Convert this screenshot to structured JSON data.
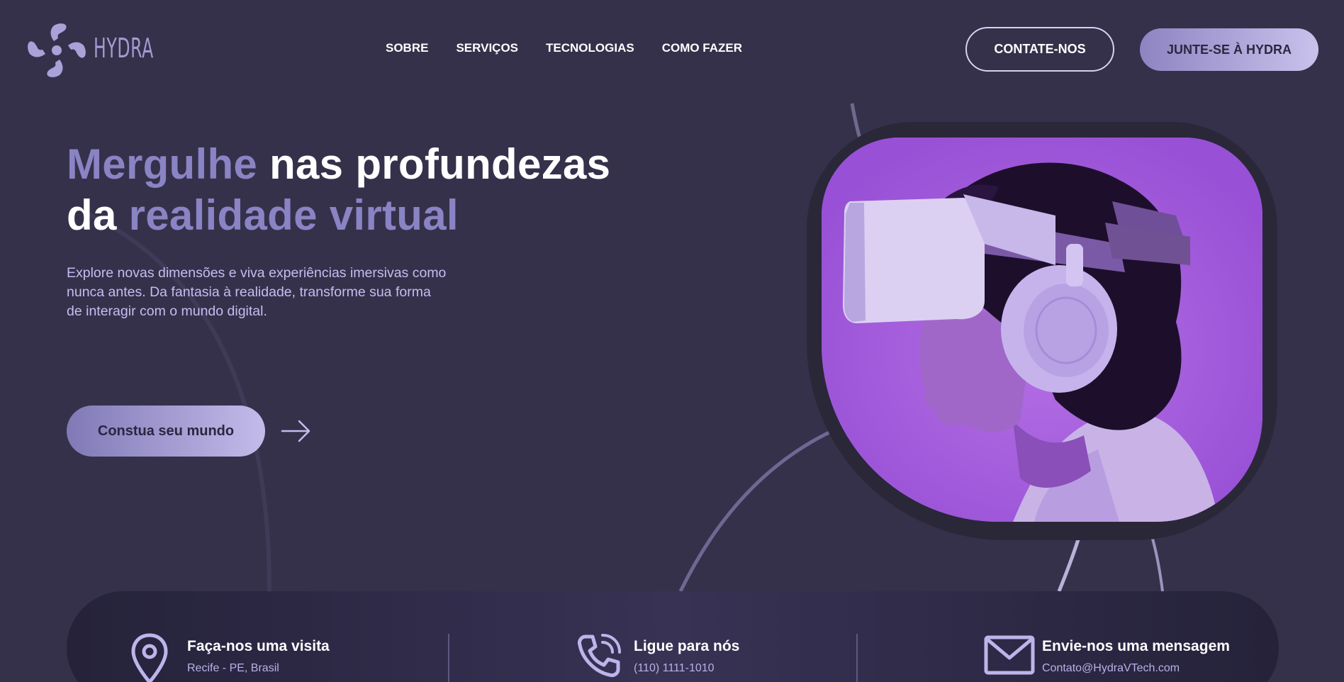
{
  "brand": {
    "name": "HYDRA",
    "logo_icon": "hydra-swirl-logo"
  },
  "nav": {
    "items": [
      "SOBRE",
      "SERVIÇOS",
      "TECNOLOGIAS",
      "COMO FAZER"
    ]
  },
  "header_buttons": {
    "contact": "CONTATE-NOS",
    "join": "JUNTE-SE À HYDRA"
  },
  "hero": {
    "title_part1_accent": "Mergulhe",
    "title_part2": " nas profundezas",
    "title_part3": "da ",
    "title_part4_accent": "realidade virtual",
    "subtitle": "Explore novas dimensões e viva experiências imersivas como nunca antes. Da fantasia à realidade, transforme sua forma de interagir com o mundo digital.",
    "cta_label": "Constua seu mundo",
    "cta_icon": "arrow-right-icon",
    "image_alt_subject": "person-with-vr-headset"
  },
  "contact": {
    "items": [
      {
        "icon": "location-pin-icon",
        "title": "Faça-nos uma visita",
        "value": "Recife - PE, Brasil"
      },
      {
        "icon": "phone-icon",
        "title": "Ligue para nós",
        "value": "(110) 1111-1010"
      },
      {
        "icon": "mail-icon",
        "title": "Envie-nos uma mensagem",
        "value": "Contato@HydraVTech.com"
      }
    ]
  },
  "colors": {
    "background": "#35314a",
    "accent": "#8a83c4",
    "button_gradient_start": "#8d84c2",
    "button_gradient_end": "#c9c2ec",
    "photo_purple": "#a964dd",
    "subtitle_text": "#c6bcf1"
  }
}
